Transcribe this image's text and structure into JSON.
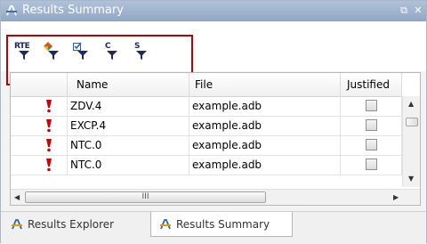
{
  "window": {
    "title": "Results Summary",
    "restore_glyph": "⧉",
    "close_glyph": "✕"
  },
  "toolbar": {
    "buttons": [
      {
        "label": "RTE",
        "icon": "rte-filter-icon"
      },
      {
        "label": "",
        "icon": "color-filter-icon"
      },
      {
        "label": "",
        "icon": "checkbox-filter-icon"
      },
      {
        "label": "C",
        "icon": "c-filter-icon"
      },
      {
        "label": "S",
        "icon": "s-filter-icon"
      }
    ]
  },
  "table": {
    "columns": [
      "",
      "Name",
      "File",
      "Justified"
    ],
    "rows": [
      {
        "name": "ZDV.4",
        "file": "example.adb",
        "justified": false
      },
      {
        "name": "EXCP.4",
        "file": "example.adb",
        "justified": false
      },
      {
        "name": "NTC.0",
        "file": "example.adb",
        "justified": false
      },
      {
        "name": "NTC.0",
        "file": "example.adb",
        "justified": false
      }
    ],
    "hscroll_grip": "III"
  },
  "tabs": [
    {
      "label": "Results Explorer",
      "active": false
    },
    {
      "label": "Results Summary",
      "active": true
    }
  ],
  "colors": {
    "title_bar": "#93a8c6",
    "highlight_box": "#c00000",
    "error_marker": "#d40000"
  }
}
